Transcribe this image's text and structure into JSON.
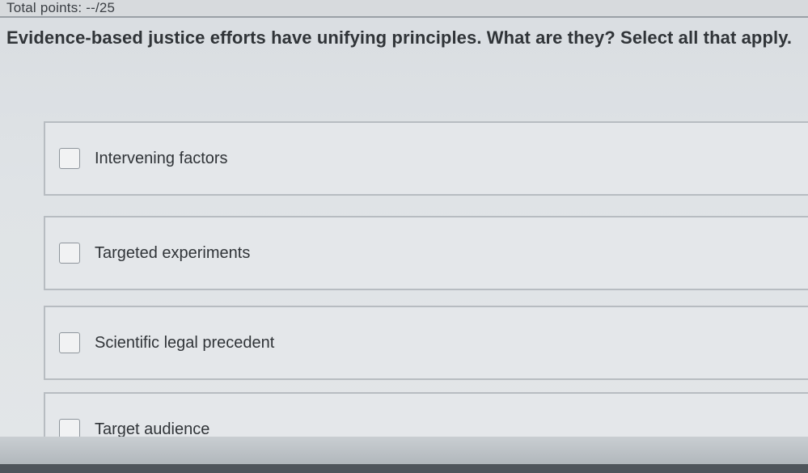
{
  "header": {
    "total_points": "Total points: --/25"
  },
  "question": {
    "prompt": "Evidence-based justice efforts have unifying principles. What are they? Select all that apply."
  },
  "options": [
    {
      "label": "Intervening factors",
      "checked": false
    },
    {
      "label": "Targeted experiments",
      "checked": false
    },
    {
      "label": "Scientific legal precedent",
      "checked": false
    },
    {
      "label": "Target audience",
      "checked": false
    }
  ]
}
